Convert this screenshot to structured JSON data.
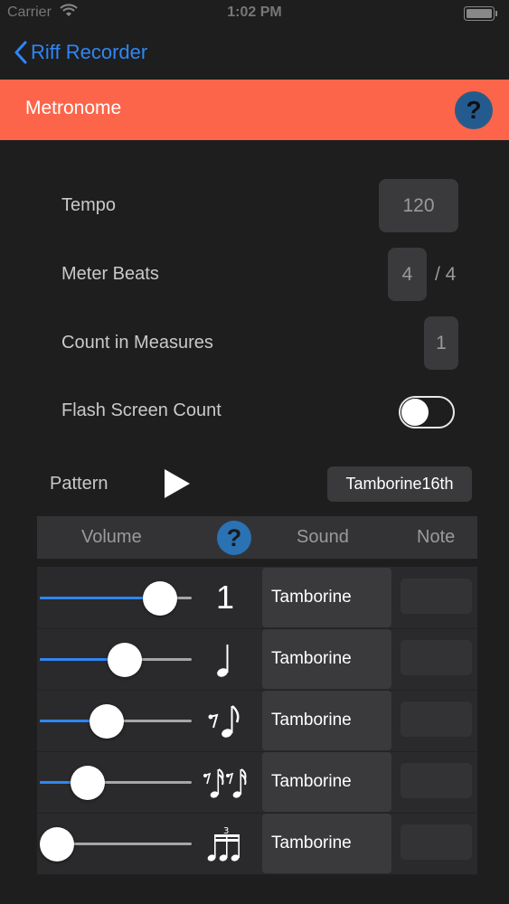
{
  "status": {
    "carrier": "Carrier",
    "time": "1:02 PM"
  },
  "nav": {
    "back_label": "Riff Recorder"
  },
  "header": {
    "title": "Metronome",
    "help": "?"
  },
  "settings": {
    "tempo": {
      "label": "Tempo",
      "value": "120"
    },
    "meter": {
      "label": "Meter Beats",
      "value": "4",
      "suffix": "/ 4"
    },
    "count_in": {
      "label": "Count in Measures",
      "value": "1"
    },
    "flash": {
      "label": "Flash Screen Count",
      "on": false
    }
  },
  "pattern": {
    "label": "Pattern",
    "value": "Tamborine16th"
  },
  "table": {
    "headers": {
      "volume": "Volume",
      "help": "?",
      "sound": "Sound",
      "note": "Note"
    },
    "rows": [
      {
        "volume": 0.88,
        "note": "whole",
        "note_text": "1",
        "sound": "Tamborine"
      },
      {
        "volume": 0.58,
        "note": "quarter-note",
        "sound": "Tamborine"
      },
      {
        "volume": 0.42,
        "note": "eighth-note",
        "sound": "Tamborine"
      },
      {
        "volume": 0.26,
        "note": "sixteenth-note",
        "sound": "Tamborine"
      },
      {
        "volume": 0.0,
        "note": "triplet",
        "note_text": "3",
        "sound": "Tamborine"
      }
    ]
  },
  "colors": {
    "accent": "#fc654a",
    "link": "#2f86f6"
  }
}
